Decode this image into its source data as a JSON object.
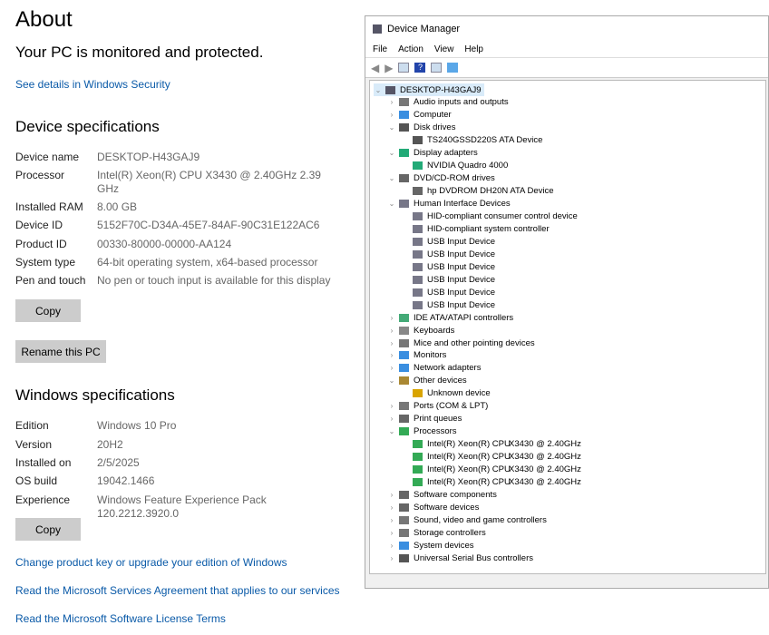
{
  "about": {
    "title": "About",
    "status": "Your PC is monitored and protected.",
    "security_link": "See details in Windows Security",
    "device_heading": "Device specifications",
    "device_specs": [
      {
        "label": "Device name",
        "value": "DESKTOP-H43GAJ9"
      },
      {
        "label": "Processor",
        "value": "Intel(R) Xeon(R) CPU          X3430  @ 2.40GHz   2.39 GHz"
      },
      {
        "label": "Installed RAM",
        "value": "8.00 GB"
      },
      {
        "label": "Device ID",
        "value": "5152F70C-D34A-45E7-84AF-90C31E122AC6"
      },
      {
        "label": "Product ID",
        "value": "00330-80000-00000-AA124"
      },
      {
        "label": "System type",
        "value": "64-bit operating system, x64-based processor"
      },
      {
        "label": "Pen and touch",
        "value": "No pen or touch input is available for this display"
      }
    ],
    "copy_label": "Copy",
    "rename_label": "Rename this PC",
    "windows_heading": "Windows specifications",
    "windows_specs": [
      {
        "label": "Edition",
        "value": "Windows 10 Pro"
      },
      {
        "label": "Version",
        "value": "20H2"
      },
      {
        "label": "Installed on",
        "value": "2/5/2025"
      },
      {
        "label": "OS build",
        "value": "19042.1466"
      },
      {
        "label": "Experience",
        "value": "Windows Feature Experience Pack 120.2212.3920.0"
      }
    ],
    "links": [
      "Change product key or upgrade your edition of Windows",
      "Read the Microsoft Services Agreement that applies to our services",
      "Read the Microsoft Software License Terms"
    ]
  },
  "device_manager": {
    "title": "Device Manager",
    "menu": [
      "File",
      "Action",
      "View",
      "Help"
    ],
    "tree": [
      {
        "label": "DESKTOP-H43GAJ9",
        "level": 0,
        "exp": "open",
        "icon": "computer",
        "color": "#556"
      },
      {
        "label": "Audio inputs and outputs",
        "level": 1,
        "exp": "closed",
        "icon": "speaker",
        "color": "#777"
      },
      {
        "label": "Computer",
        "level": 1,
        "exp": "closed",
        "icon": "monitor",
        "color": "#3a8ee0"
      },
      {
        "label": "Disk drives",
        "level": 1,
        "exp": "open",
        "icon": "disk",
        "color": "#555"
      },
      {
        "label": "TS240GSSD220S ATA Device",
        "level": 2,
        "icon": "disk",
        "color": "#555"
      },
      {
        "label": "Display adapters",
        "level": 1,
        "exp": "open",
        "icon": "display",
        "color": "#2a7"
      },
      {
        "label": "NVIDIA Quadro 4000",
        "level": 2,
        "icon": "display",
        "color": "#2a7"
      },
      {
        "label": "DVD/CD-ROM drives",
        "level": 1,
        "exp": "open",
        "icon": "dvd",
        "color": "#666"
      },
      {
        "label": "hp DVDROM DH20N ATA Device",
        "level": 2,
        "icon": "dvd",
        "color": "#666"
      },
      {
        "label": "Human Interface Devices",
        "level": 1,
        "exp": "open",
        "icon": "hid",
        "color": "#778"
      },
      {
        "label": "HID-compliant consumer control device",
        "level": 2,
        "icon": "hid",
        "color": "#778"
      },
      {
        "label": "HID-compliant system controller",
        "level": 2,
        "icon": "hid",
        "color": "#778"
      },
      {
        "label": "USB Input Device",
        "level": 2,
        "icon": "hid",
        "color": "#778"
      },
      {
        "label": "USB Input Device",
        "level": 2,
        "icon": "hid",
        "color": "#778"
      },
      {
        "label": "USB Input Device",
        "level": 2,
        "icon": "hid",
        "color": "#778"
      },
      {
        "label": "USB Input Device",
        "level": 2,
        "icon": "hid",
        "color": "#778"
      },
      {
        "label": "USB Input Device",
        "level": 2,
        "icon": "hid",
        "color": "#778"
      },
      {
        "label": "USB Input Device",
        "level": 2,
        "icon": "hid",
        "color": "#778"
      },
      {
        "label": "IDE ATA/ATAPI controllers",
        "level": 1,
        "exp": "closed",
        "icon": "ide",
        "color": "#4a7"
      },
      {
        "label": "Keyboards",
        "level": 1,
        "exp": "closed",
        "icon": "keyboard",
        "color": "#888"
      },
      {
        "label": "Mice and other pointing devices",
        "level": 1,
        "exp": "closed",
        "icon": "mouse",
        "color": "#777"
      },
      {
        "label": "Monitors",
        "level": 1,
        "exp": "closed",
        "icon": "monitor",
        "color": "#3a8ee0"
      },
      {
        "label": "Network adapters",
        "level": 1,
        "exp": "closed",
        "icon": "network",
        "color": "#3a8ee0"
      },
      {
        "label": "Other devices",
        "level": 1,
        "exp": "open",
        "icon": "other",
        "color": "#a83"
      },
      {
        "label": "Unknown device",
        "level": 2,
        "icon": "warning",
        "color": "#d9a400"
      },
      {
        "label": "Ports (COM & LPT)",
        "level": 1,
        "exp": "closed",
        "icon": "port",
        "color": "#777"
      },
      {
        "label": "Print queues",
        "level": 1,
        "exp": "closed",
        "icon": "printer",
        "color": "#666"
      },
      {
        "label": "Processors",
        "level": 1,
        "exp": "open",
        "icon": "cpu",
        "color": "#3a5"
      },
      {
        "label": "Intel(R) Xeon(R) CPU",
        "extra": "X3430  @ 2.40GHz",
        "level": 2,
        "icon": "cpu",
        "color": "#3a5"
      },
      {
        "label": "Intel(R) Xeon(R) CPU",
        "extra": "X3430  @ 2.40GHz",
        "level": 2,
        "icon": "cpu",
        "color": "#3a5"
      },
      {
        "label": "Intel(R) Xeon(R) CPU",
        "extra": "X3430  @ 2.40GHz",
        "level": 2,
        "icon": "cpu",
        "color": "#3a5"
      },
      {
        "label": "Intel(R) Xeon(R) CPU",
        "extra": "X3430  @ 2.40GHz",
        "level": 2,
        "icon": "cpu",
        "color": "#3a5"
      },
      {
        "label": "Software components",
        "level": 1,
        "exp": "closed",
        "icon": "component",
        "color": "#666"
      },
      {
        "label": "Software devices",
        "level": 1,
        "exp": "closed",
        "icon": "component",
        "color": "#666"
      },
      {
        "label": "Sound, video and game controllers",
        "level": 1,
        "exp": "closed",
        "icon": "speaker",
        "color": "#777"
      },
      {
        "label": "Storage controllers",
        "level": 1,
        "exp": "closed",
        "icon": "storage",
        "color": "#777"
      },
      {
        "label": "System devices",
        "level": 1,
        "exp": "closed",
        "icon": "system",
        "color": "#3a8ee0"
      },
      {
        "label": "Universal Serial Bus controllers",
        "level": 1,
        "exp": "closed",
        "icon": "usb",
        "color": "#555"
      }
    ]
  }
}
